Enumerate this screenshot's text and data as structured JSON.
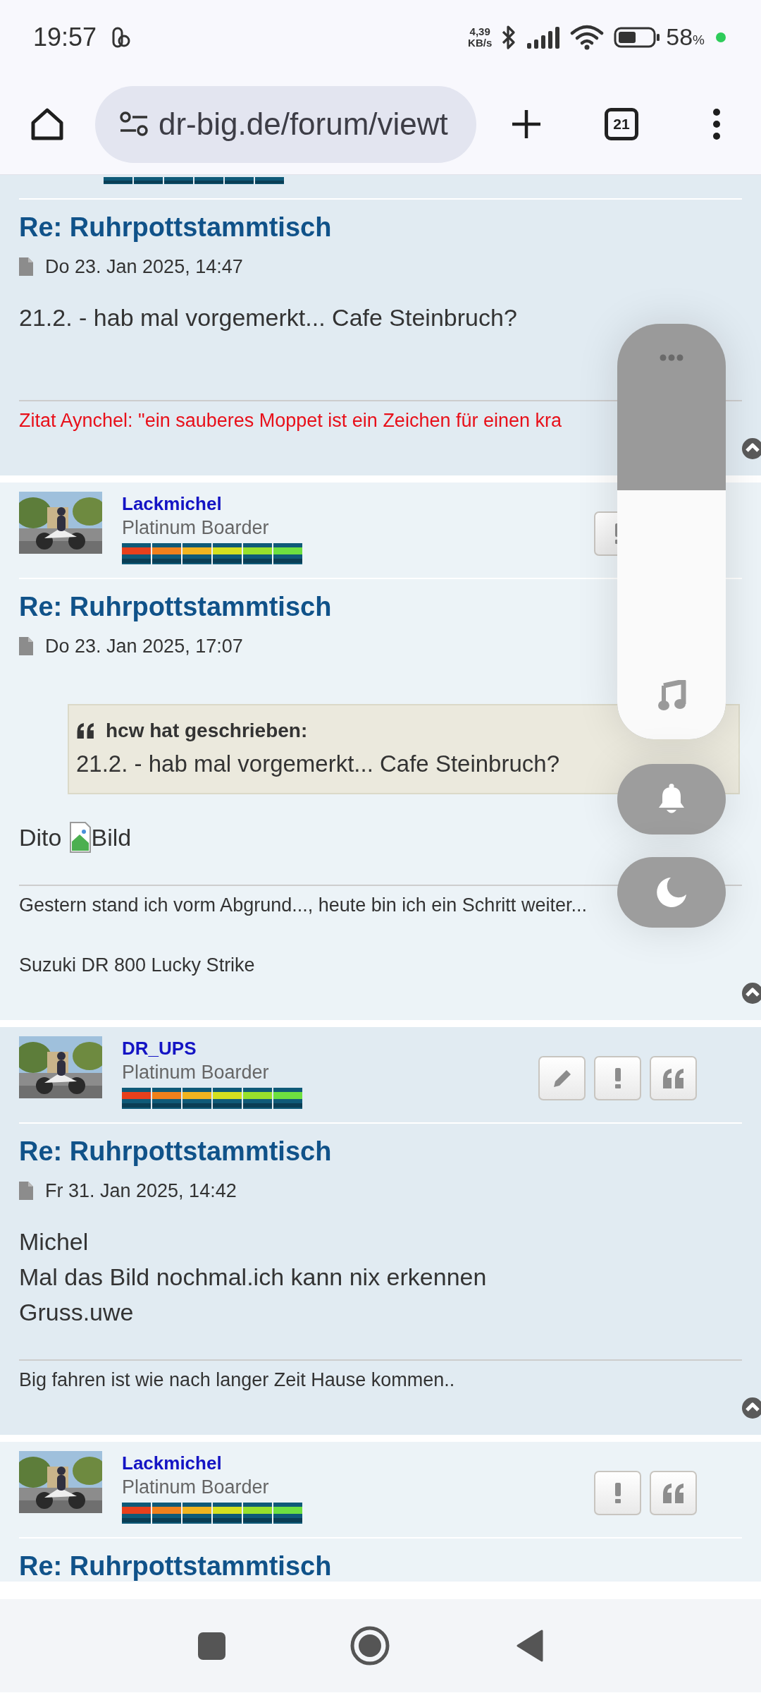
{
  "status_bar": {
    "time": "19:57",
    "net_speed": "4,39",
    "net_unit": "KB/s",
    "battery_percent": "58",
    "battery_unit": "%"
  },
  "browser": {
    "url": "dr-big.de/forum/viewt",
    "tab_count": "21"
  },
  "posts": [
    {
      "header_visible": false,
      "title": "Re: Ruhrpottstammtisch",
      "date": "Do 23. Jan 2025, 14:47",
      "body": [
        {
          "text": "21.2. - hab mal vorgemerkt... Cafe Steinbruch?"
        }
      ],
      "signature": [
        {
          "text": "Zitat Aynchel: \"ein sauberes Moppet ist ein Zeichen für einen kra",
          "color": "#e8101a"
        }
      ]
    },
    {
      "header_visible": true,
      "author": {
        "name": "Lackmichel",
        "rank": "Platinum Boarder"
      },
      "buttons": [
        {
          "kind": "report"
        }
      ],
      "title": "Re: Ruhrpottstammtisch",
      "date": "Do 23. Jan 2025, 17:07",
      "quote": {
        "author_line": "hcw hat geschrieben:",
        "text": "21.2. - hab mal vorgemerkt... Cafe Steinbruch?"
      },
      "body": [
        {
          "text": "Dito",
          "image_alt": "Bild"
        }
      ],
      "signature": [
        {
          "text": "Gestern stand ich vorm Abgrund..., heute bin ich ein Schritt weiter...",
          "color": "#333333"
        },
        {
          "text": "Suzuki DR 800 Lucky Strike",
          "color": "#333333"
        }
      ]
    },
    {
      "header_visible": true,
      "author": {
        "name": "DR_UPS",
        "rank": "Platinum Boarder"
      },
      "buttons": [
        {
          "kind": "edit"
        },
        {
          "kind": "report"
        },
        {
          "kind": "quote"
        }
      ],
      "title": "Re: Ruhrpottstammtisch",
      "date": "Fr 31. Jan 2025, 14:42",
      "body": [
        {
          "text": "Michel"
        },
        {
          "text": "Mal das Bild nochmal.ich kann nix erkennen"
        },
        {
          "text": "Gruss.uwe"
        }
      ],
      "signature": [
        {
          "text": "Big fahren ist wie nach langer Zeit Hause kommen..",
          "color": "#333333"
        }
      ]
    },
    {
      "header_visible": true,
      "author": {
        "name": "Lackmichel",
        "rank": "Platinum Boarder"
      },
      "buttons": [
        {
          "kind": "report"
        },
        {
          "kind": "quote"
        }
      ],
      "title": "Re: Ruhrpottstammtisch"
    }
  ],
  "volume_panel": {
    "level": 0.6
  }
}
